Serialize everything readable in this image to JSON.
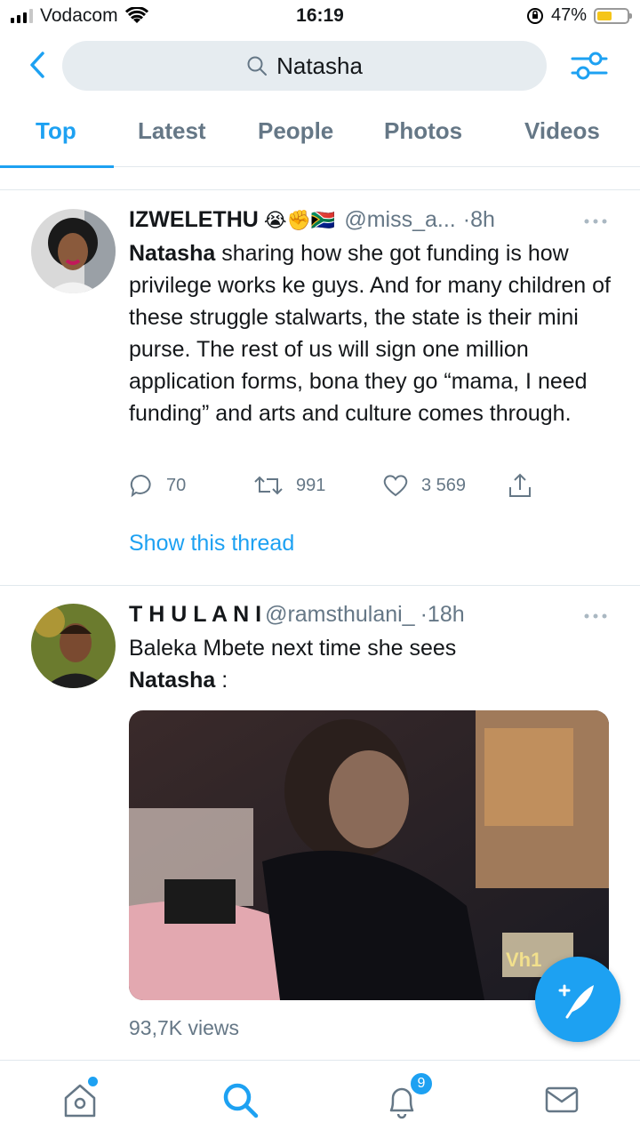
{
  "status_bar": {
    "carrier": "Vodacom",
    "time": "16:19",
    "battery": "47%"
  },
  "search": {
    "query": "Natasha",
    "back_icon": "chevron-left-icon",
    "filter_icon": "sliders-icon"
  },
  "tabs": [
    {
      "label": "Top",
      "active": true
    },
    {
      "label": "Latest",
      "active": false
    },
    {
      "label": "People",
      "active": false
    },
    {
      "label": "Photos",
      "active": false
    },
    {
      "label": "Videos",
      "active": false
    }
  ],
  "tweets": [
    {
      "name": "IZWELETHU",
      "emojis": "😭✊🇿🇦",
      "handle": "@miss_a...",
      "sep": "·",
      "time": "8h",
      "text_bold": "Natasha",
      "text": " sharing how she got funding is how privilege works ke guys. And for many children of these struggle stalwarts, the state is their mini purse. The rest of us will sign one million application forms, bona they go “mama, I need funding” and arts and culture comes through.",
      "replies": "70",
      "retweets": "991",
      "likes": "3 569",
      "show_thread": "Show this thread"
    },
    {
      "name": "T H U L A N I",
      "handle": "@ramsthulani_",
      "sep": "·",
      "time": "18h",
      "text": "Baleka Mbete next time she sees ",
      "text_bold": "Natasha",
      "text_end": " :",
      "media_watermark": "Vh1",
      "views": "93,7K views"
    }
  ],
  "bottom_nav": {
    "notifications_badge": "9",
    "items": [
      "home-icon",
      "search-icon",
      "bell-icon",
      "mail-icon"
    ]
  },
  "colors": {
    "accent": "#1da1f2",
    "muted": "#657786",
    "text": "#14171a"
  }
}
